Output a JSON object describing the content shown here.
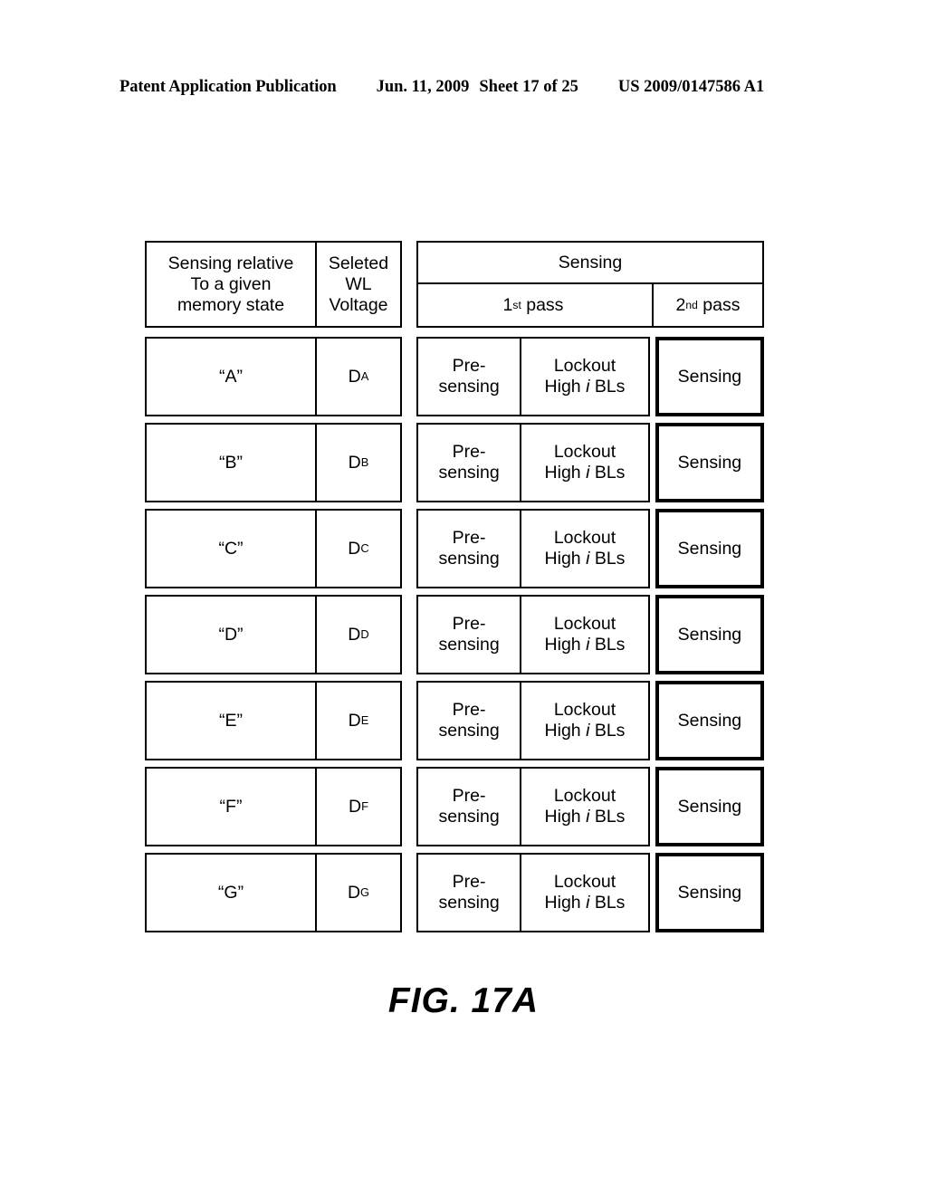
{
  "header": {
    "publication": "Patent Application Publication",
    "date": "Jun. 11, 2009",
    "sheet": "Sheet 17 of 25",
    "patent_number": "US 2009/0147586 A1"
  },
  "figure": {
    "caption": "FIG. 17A"
  },
  "table": {
    "headers": {
      "col1_line1": "Sensing relative",
      "col1_line2": "To a given",
      "col1_line3": "memory state",
      "col2_line1": "Seleted",
      "col2_line2": "WL",
      "col2_line3": "Voltage",
      "sensing_group": "Sensing",
      "first_pass_num": "1",
      "first_pass_sup": "st",
      "first_pass_word": "pass",
      "second_pass_num": "2",
      "second_pass_sup": "nd",
      "second_pass_word": "pass"
    },
    "rows": [
      {
        "state": "“A”",
        "voltage_base": "D",
        "voltage_sub": "A",
        "presensing_line1": "Pre-",
        "presensing_line2": "sensing",
        "lockout_line1": "Lockout",
        "lockout_high": "High",
        "lockout_i": "i",
        "lockout_bls": "BLs",
        "second_pass": "Sensing"
      },
      {
        "state": "“B”",
        "voltage_base": "D",
        "voltage_sub": "B",
        "presensing_line1": "Pre-",
        "presensing_line2": "sensing",
        "lockout_line1": "Lockout",
        "lockout_high": "High",
        "lockout_i": "i",
        "lockout_bls": "BLs",
        "second_pass": "Sensing"
      },
      {
        "state": "“C”",
        "voltage_base": "D",
        "voltage_sub": "C",
        "presensing_line1": "Pre-",
        "presensing_line2": "sensing",
        "lockout_line1": "Lockout",
        "lockout_high": "High",
        "lockout_i": "i",
        "lockout_bls": "BLs",
        "second_pass": "Sensing"
      },
      {
        "state": "“D”",
        "voltage_base": "D",
        "voltage_sub": "D",
        "presensing_line1": "Pre-",
        "presensing_line2": "sensing",
        "lockout_line1": "Lockout",
        "lockout_high": "High",
        "lockout_i": "i",
        "lockout_bls": "BLs",
        "second_pass": "Sensing"
      },
      {
        "state": "“E”",
        "voltage_base": "D",
        "voltage_sub": "E",
        "presensing_line1": "Pre-",
        "presensing_line2": "sensing",
        "lockout_line1": "Lockout",
        "lockout_high": "High",
        "lockout_i": "i",
        "lockout_bls": "BLs",
        "second_pass": "Sensing"
      },
      {
        "state": "“F”",
        "voltage_base": "D",
        "voltage_sub": "F",
        "presensing_line1": "Pre-",
        "presensing_line2": "sensing",
        "lockout_line1": "Lockout",
        "lockout_high": "High",
        "lockout_i": "i",
        "lockout_bls": "BLs",
        "second_pass": "Sensing"
      },
      {
        "state": "“G”",
        "voltage_base": "D",
        "voltage_sub": "G",
        "presensing_line1": "Pre-",
        "presensing_line2": "sensing",
        "lockout_line1": "Lockout",
        "lockout_high": "High",
        "lockout_i": "i",
        "lockout_bls": "BLs",
        "second_pass": "Sensing"
      }
    ]
  }
}
